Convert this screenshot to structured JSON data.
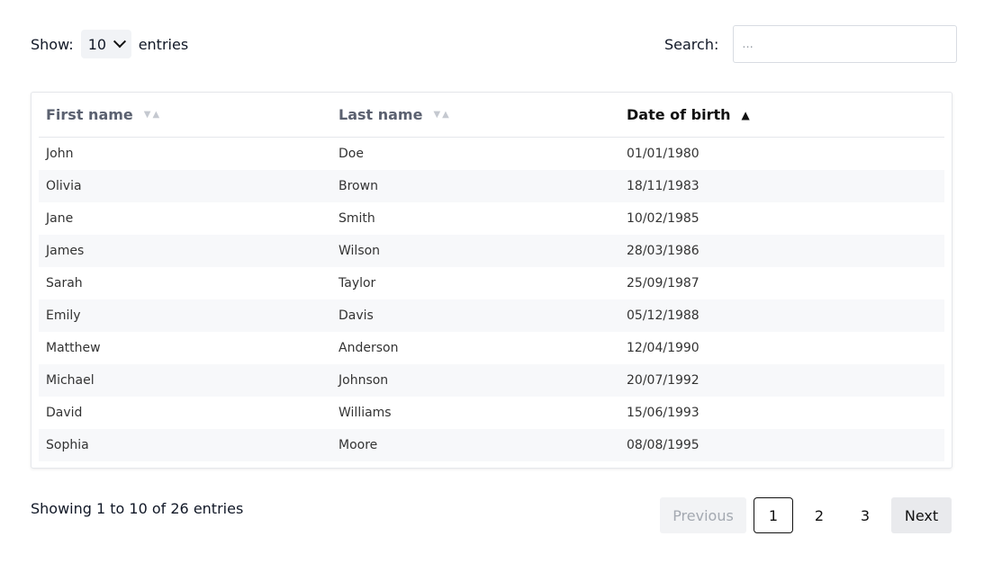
{
  "controls": {
    "show_label": "Show:",
    "entries_value": "10",
    "entries_label": "entries",
    "search_label": "Search:",
    "search_placeholder": "..."
  },
  "table": {
    "columns": [
      {
        "label": "First name",
        "sort": "none"
      },
      {
        "label": "Last name",
        "sort": "none"
      },
      {
        "label": "Date of birth",
        "sort": "ascending"
      }
    ],
    "rows": [
      [
        "John",
        "Doe",
        "01/01/1980"
      ],
      [
        "Olivia",
        "Brown",
        "18/11/1983"
      ],
      [
        "Jane",
        "Smith",
        "10/02/1985"
      ],
      [
        "James",
        "Wilson",
        "28/03/1986"
      ],
      [
        "Sarah",
        "Taylor",
        "25/09/1987"
      ],
      [
        "Emily",
        "Davis",
        "05/12/1988"
      ],
      [
        "Matthew",
        "Anderson",
        "12/04/1990"
      ],
      [
        "Michael",
        "Johnson",
        "20/07/1992"
      ],
      [
        "David",
        "Williams",
        "15/06/1993"
      ],
      [
        "Sophia",
        "Moore",
        "08/08/1995"
      ]
    ]
  },
  "footer": {
    "info": "Showing 1 to 10 of 26 entries",
    "previous": "Previous",
    "pages": [
      "1",
      "2",
      "3"
    ],
    "current_page": "1",
    "next": "Next"
  }
}
